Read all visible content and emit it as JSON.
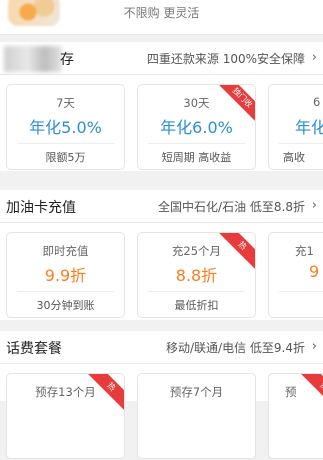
{
  "banner": {
    "tagline": "不限购 更灵活"
  },
  "sections": [
    {
      "title": "存",
      "desc": "四重还款来源 100%安全保障",
      "cards": [
        {
          "label": "7天",
          "rate": "年化5.0%",
          "foot": "限额5万",
          "ribbon": ""
        },
        {
          "label": "30天",
          "rate": "年化6.0%",
          "foot": "短周期 高收益",
          "ribbon": "独门收"
        },
        {
          "label": "6",
          "rate": "年化",
          "foot": "高收",
          "ribbon": ""
        }
      ]
    },
    {
      "title": "加油卡充值",
      "desc": "全国中石化/石油 低至8.8折",
      "cards": [
        {
          "label": "即时充值",
          "rate": "9.9折",
          "foot": "30分钟到账",
          "ribbon": ""
        },
        {
          "label": "充25个月",
          "rate": "8.8折",
          "foot": "最低折扣",
          "ribbon": "热"
        },
        {
          "label": "充1",
          "rate": "9",
          "foot": "",
          "ribbon": ""
        }
      ]
    },
    {
      "title": "话费套餐",
      "desc": "移动/联通/电信 低至9.4折",
      "cards": [
        {
          "label": "预存13个月",
          "rate": "",
          "foot": "",
          "ribbon": "热"
        },
        {
          "label": "预存7个月",
          "rate": "",
          "foot": "",
          "ribbon": ""
        },
        {
          "label": "预",
          "rate": "",
          "foot": "",
          "ribbon": "热"
        }
      ]
    }
  ],
  "chevron": "›"
}
